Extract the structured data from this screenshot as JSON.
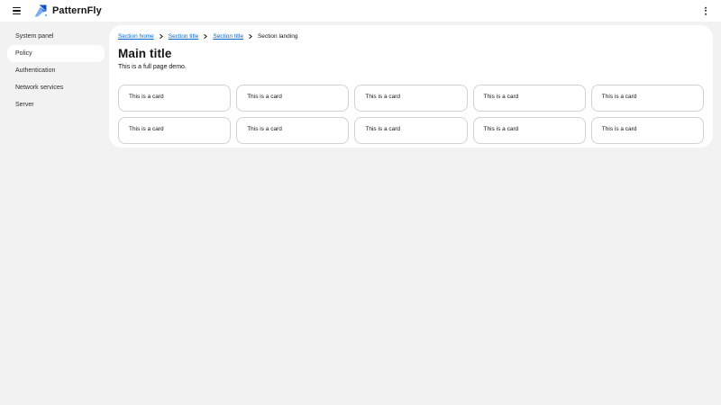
{
  "header": {
    "brand": "PatternFly"
  },
  "sidebar": {
    "items": [
      {
        "label": "System panel",
        "selected": false
      },
      {
        "label": "Policy",
        "selected": true
      },
      {
        "label": "Authentication",
        "selected": false
      },
      {
        "label": "Network services",
        "selected": false
      },
      {
        "label": "Server",
        "selected": false
      }
    ]
  },
  "main": {
    "breadcrumb": [
      {
        "label": "Section home",
        "link": true
      },
      {
        "label": "Section title",
        "link": true
      },
      {
        "label": "Section title",
        "link": true
      },
      {
        "label": "Section landing",
        "link": false
      }
    ],
    "title": "Main title",
    "subtitle": "This is a full page demo.",
    "cards": [
      "This is a card",
      "This is a card",
      "This is a card",
      "This is a card",
      "This is a card",
      "This is a card",
      "This is a card",
      "This is a card",
      "This is a card",
      "This is a card"
    ]
  },
  "icons": {
    "hamburger": "three-horizontal-bars",
    "kebab": "vertical-ellipsis",
    "breadcrumb_separator": "chevron-right",
    "brand_logo": "patternfly-mark"
  },
  "colors": {
    "link_blue": "#0066cc",
    "background_gray": "#f2f2f2",
    "text_dark": "#151515",
    "card_border": "#d2d2d2",
    "logo_dark_blue": "#1250c4",
    "logo_mid_blue": "#3c78de",
    "logo_light_blue": "#7fb0ee"
  }
}
